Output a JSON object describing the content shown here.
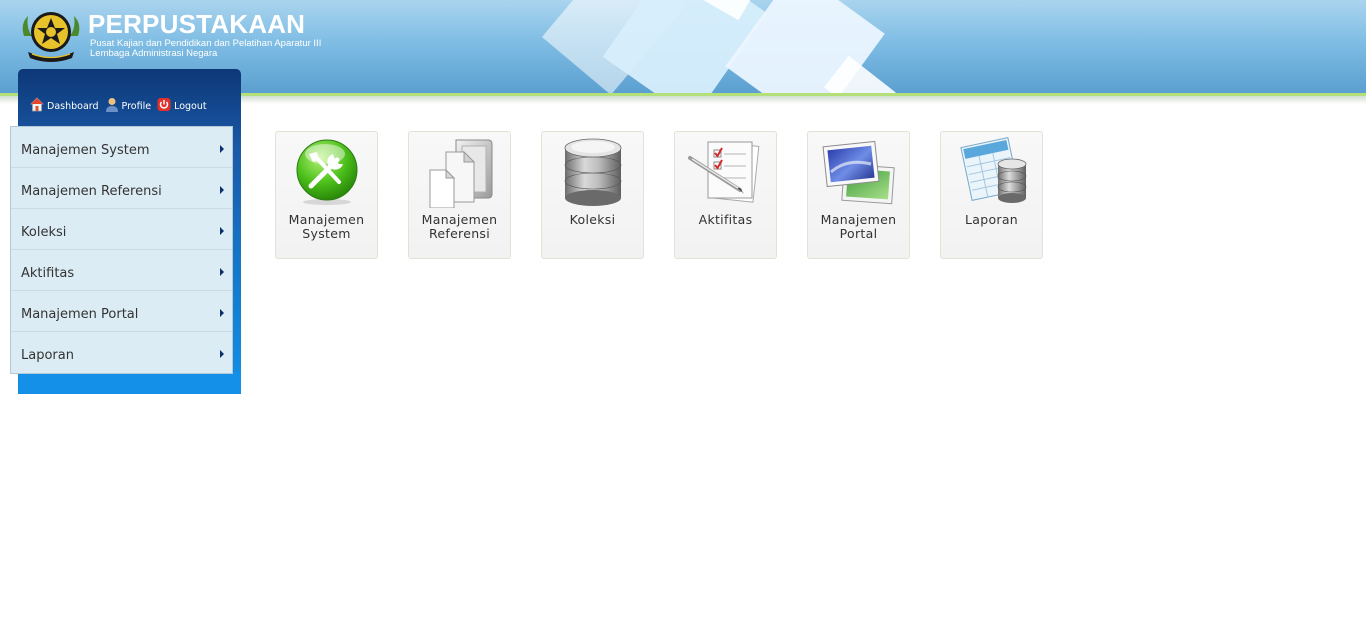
{
  "header": {
    "title": "PERPUSTAKAAN",
    "subtitle_line1": "Pusat Kajian dan Pendidikan dan Pelatihan Aparatur III",
    "subtitle_line2": "Lembaga Administrasi Negara",
    "colors": {
      "accent_line": "#b4e07a",
      "header_blue": "#7fbde4"
    }
  },
  "top_links": [
    {
      "label": "Dashboard",
      "icon": "home-icon"
    },
    {
      "label": "Profile",
      "icon": "user-icon"
    },
    {
      "label": "Logout",
      "icon": "power-icon"
    }
  ],
  "sidebar": {
    "items": [
      {
        "label": "Manajemen System"
      },
      {
        "label": "Manajemen Referensi"
      },
      {
        "label": "Koleksi"
      },
      {
        "label": "Aktifitas"
      },
      {
        "label": "Manajemen Portal"
      },
      {
        "label": "Laporan"
      }
    ]
  },
  "tiles": [
    {
      "line1": "Manajemen",
      "line2": "System",
      "icon": "tools-icon"
    },
    {
      "line1": "Manajemen",
      "line2": "Referensi",
      "icon": "documents-icon"
    },
    {
      "line1": "Koleksi",
      "line2": "",
      "icon": "database-icon"
    },
    {
      "line1": "Aktifitas",
      "line2": "",
      "icon": "checklist-icon"
    },
    {
      "line1": "Manajemen",
      "line2": "Portal",
      "icon": "monitor-icon"
    },
    {
      "line1": "Laporan",
      "line2": "",
      "icon": "report-icon"
    }
  ]
}
